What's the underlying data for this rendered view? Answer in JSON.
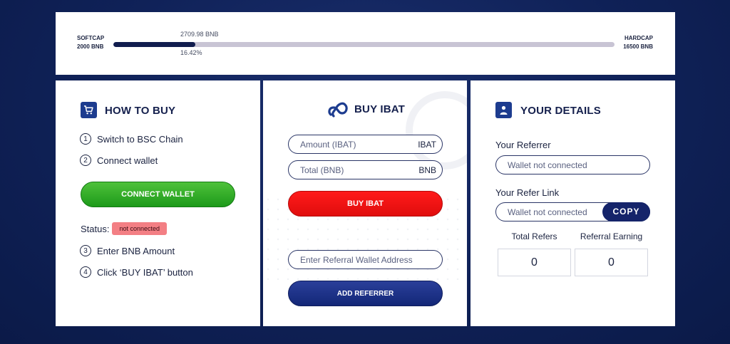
{
  "progress": {
    "softcap_label": "SOFTCAP",
    "softcap_value": "2000 BNB",
    "hardcap_label": "HARDCAP",
    "hardcap_value": "16500 BNB",
    "raised": "2709.98 BNB",
    "percent": "16.42%",
    "fill_fraction": 0.1642,
    "colors": {
      "fill": "#111d4e",
      "track": "#c8c4d4"
    }
  },
  "how_to_buy": {
    "title": "HOW TO BUY",
    "icon": "cart-icon",
    "steps": [
      {
        "num": "1",
        "text": "Switch to BSC Chain"
      },
      {
        "num": "2",
        "text": "Connect wallet"
      },
      {
        "num": "3",
        "text": "Enter BNB Amount"
      },
      {
        "num": "4",
        "text": "Click ‘BUY IBAT’ button"
      }
    ],
    "connect_label": "CONNECT WALLET",
    "status_label": "Status:",
    "status_value": "not connected"
  },
  "buy": {
    "title": "BUY IBAT",
    "logo_icon": "infinity-logo-icon",
    "amount_placeholder": "Amount (IBAT)",
    "amount_suffix": "IBAT",
    "total_placeholder": "Total (BNB)",
    "total_suffix": "BNB",
    "buy_label": "BUY IBAT",
    "referral_placeholder": "Enter Referral Wallet Address",
    "add_referrer_label": "ADD REFERRER"
  },
  "details": {
    "title": "YOUR DETAILS",
    "icon": "user-card-icon",
    "referrer_label": "Your Referrer",
    "referrer_value": "Wallet not connected",
    "refer_link_label": "Your Refer Link",
    "refer_link_value": "Wallet not connected",
    "copy_label": "COPY",
    "total_refers_label": "Total Refers",
    "total_refers_value": "0",
    "referral_earning_label": "Referral Earning",
    "referral_earning_value": "0"
  },
  "colors": {
    "background": "#0f2157",
    "connect_green": "#1d9a1a",
    "buy_red": "#e00d0d",
    "add_blue": "#132777",
    "status_badge": "#f37f84"
  }
}
